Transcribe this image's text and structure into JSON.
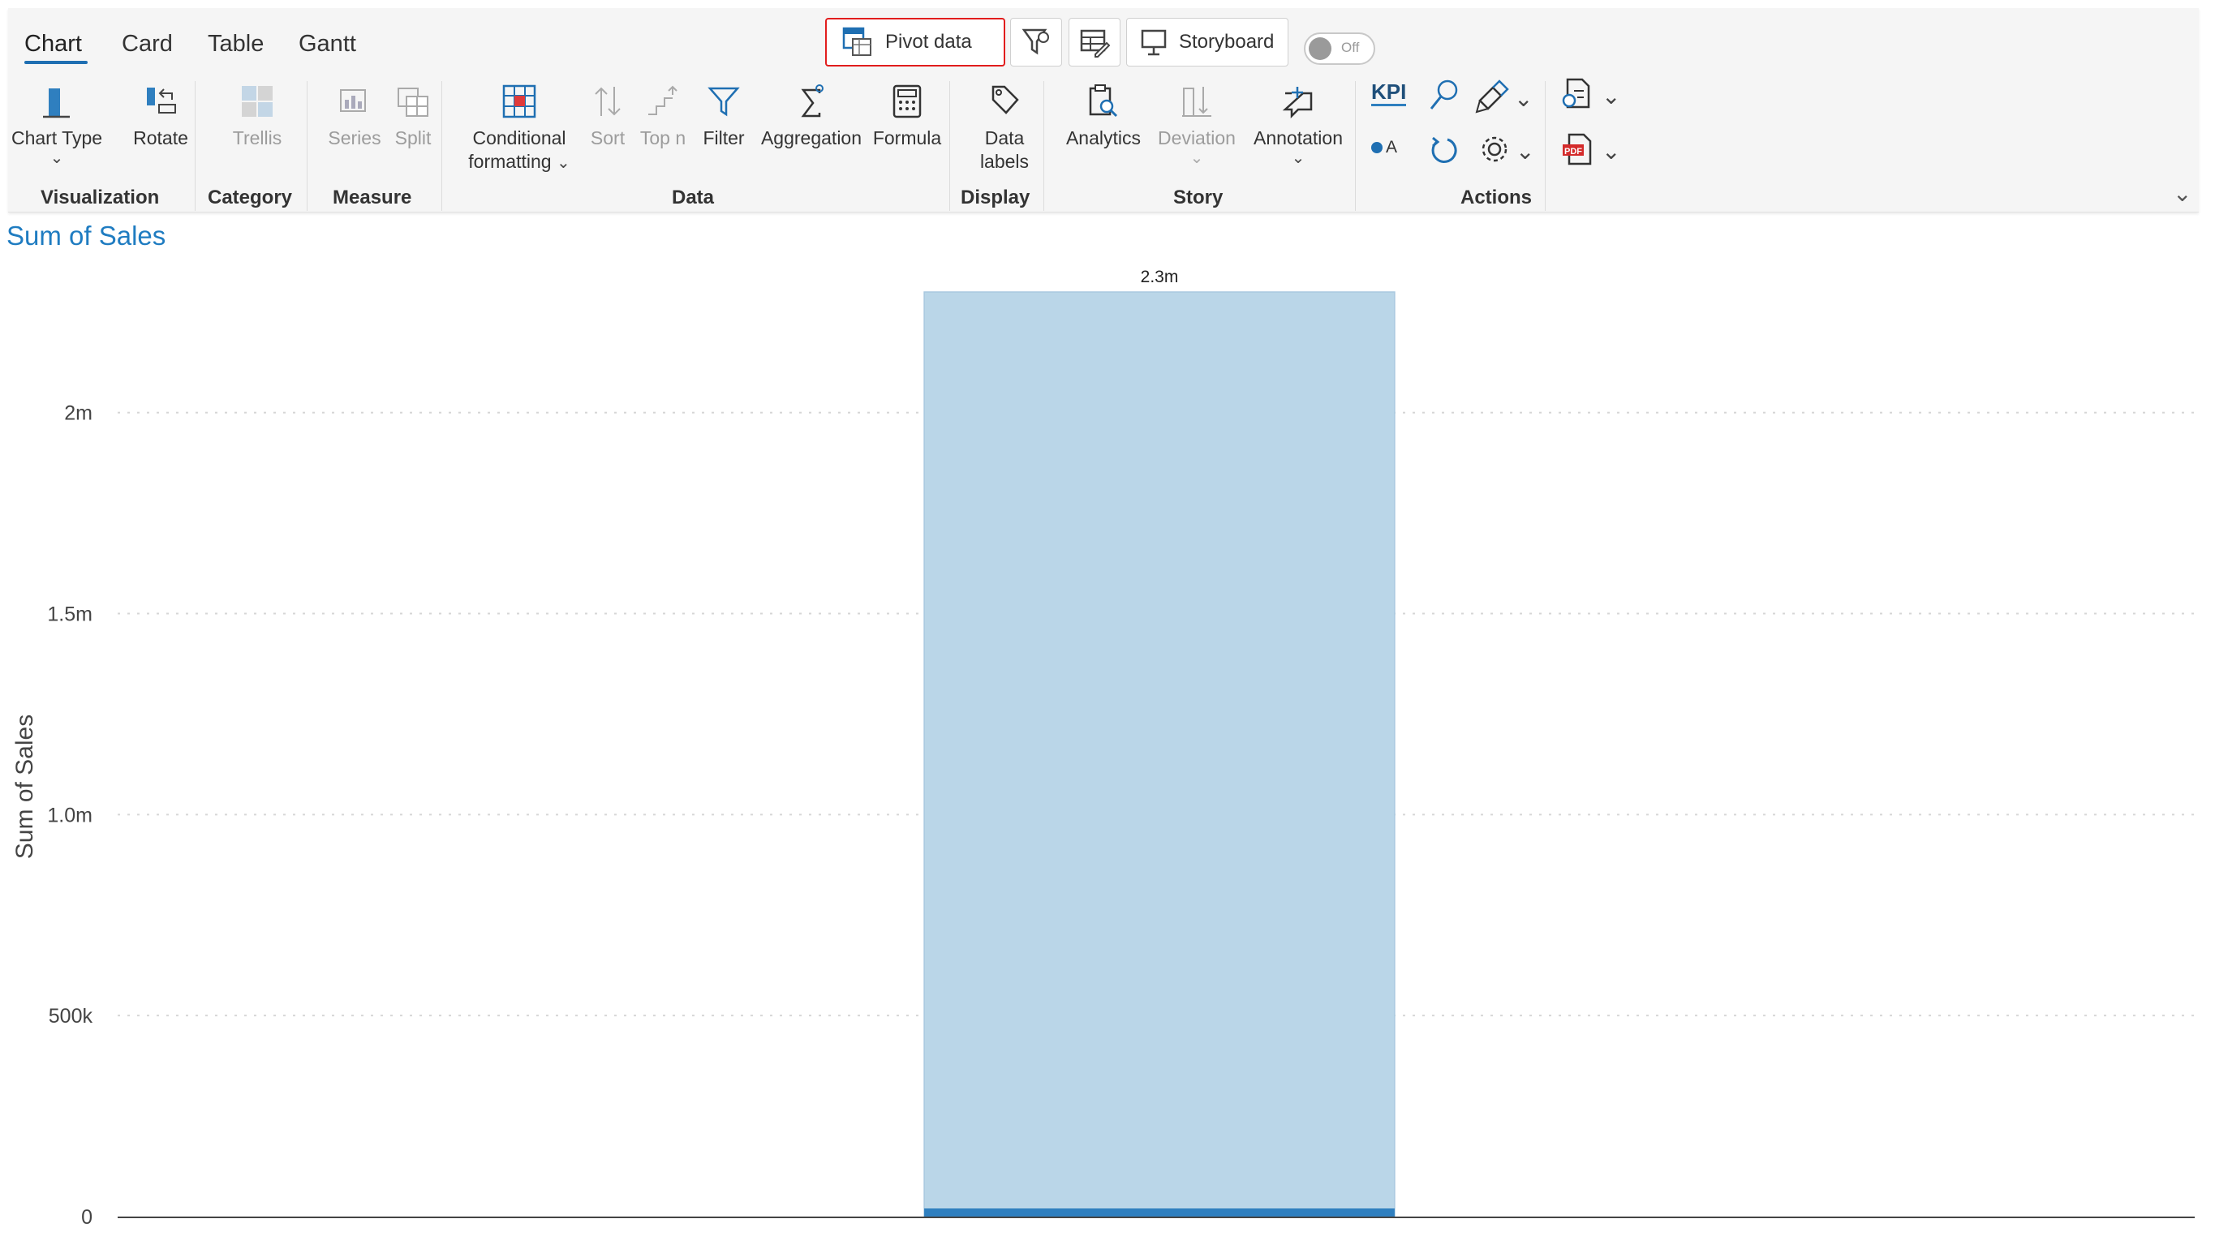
{
  "tabs": [
    {
      "label": "Chart",
      "active": true
    },
    {
      "label": "Card",
      "active": false
    },
    {
      "label": "Table",
      "active": false
    },
    {
      "label": "Gantt",
      "active": false
    }
  ],
  "toolbar": {
    "pivot_label": "Pivot data",
    "storyboard_label": "Storyboard",
    "toggle_label": "Off"
  },
  "ribbon": {
    "visualization": {
      "group": "Visualization",
      "chart_type": "Chart Type",
      "rotate": "Rotate"
    },
    "category": {
      "group": "Category",
      "trellis": "Trellis"
    },
    "measure": {
      "group": "Measure",
      "series": "Series",
      "split": "Split"
    },
    "data": {
      "group": "Data",
      "cond_line1": "Conditional",
      "cond_line2": "formatting",
      "sort": "Sort",
      "topn": "Top n",
      "filter": "Filter",
      "aggregation": "Aggregation",
      "formula": "Formula"
    },
    "display": {
      "group": "Display",
      "labels_line1": "Data",
      "labels_line2": "labels"
    },
    "story": {
      "group": "Story",
      "analytics": "Analytics",
      "deviation": "Deviation",
      "annotation": "Annotation"
    },
    "actions": {
      "group": "Actions",
      "kpi": "KPI",
      "legend_a": "A"
    }
  },
  "colors": {
    "accent": "#1f7cc1",
    "bar": "#bad6e8",
    "bar_edge": "#2f7fbf",
    "highlight": "#e11d1d"
  },
  "chart": {
    "title": "Sum of Sales",
    "ylabel": "Sum of Sales"
  },
  "chart_data": {
    "type": "bar",
    "categories": [
      ""
    ],
    "values": [
      2300000
    ],
    "data_labels": [
      "2.3m"
    ],
    "title": "Sum of Sales",
    "xlabel": "",
    "ylabel": "Sum of Sales",
    "ylim": [
      0,
      2300000
    ],
    "yticks": [
      0,
      500000,
      1000000,
      1500000,
      2000000
    ],
    "ytick_labels": [
      "0",
      "500k",
      "1.0m",
      "1.5m",
      "2m"
    ],
    "grid": true
  }
}
